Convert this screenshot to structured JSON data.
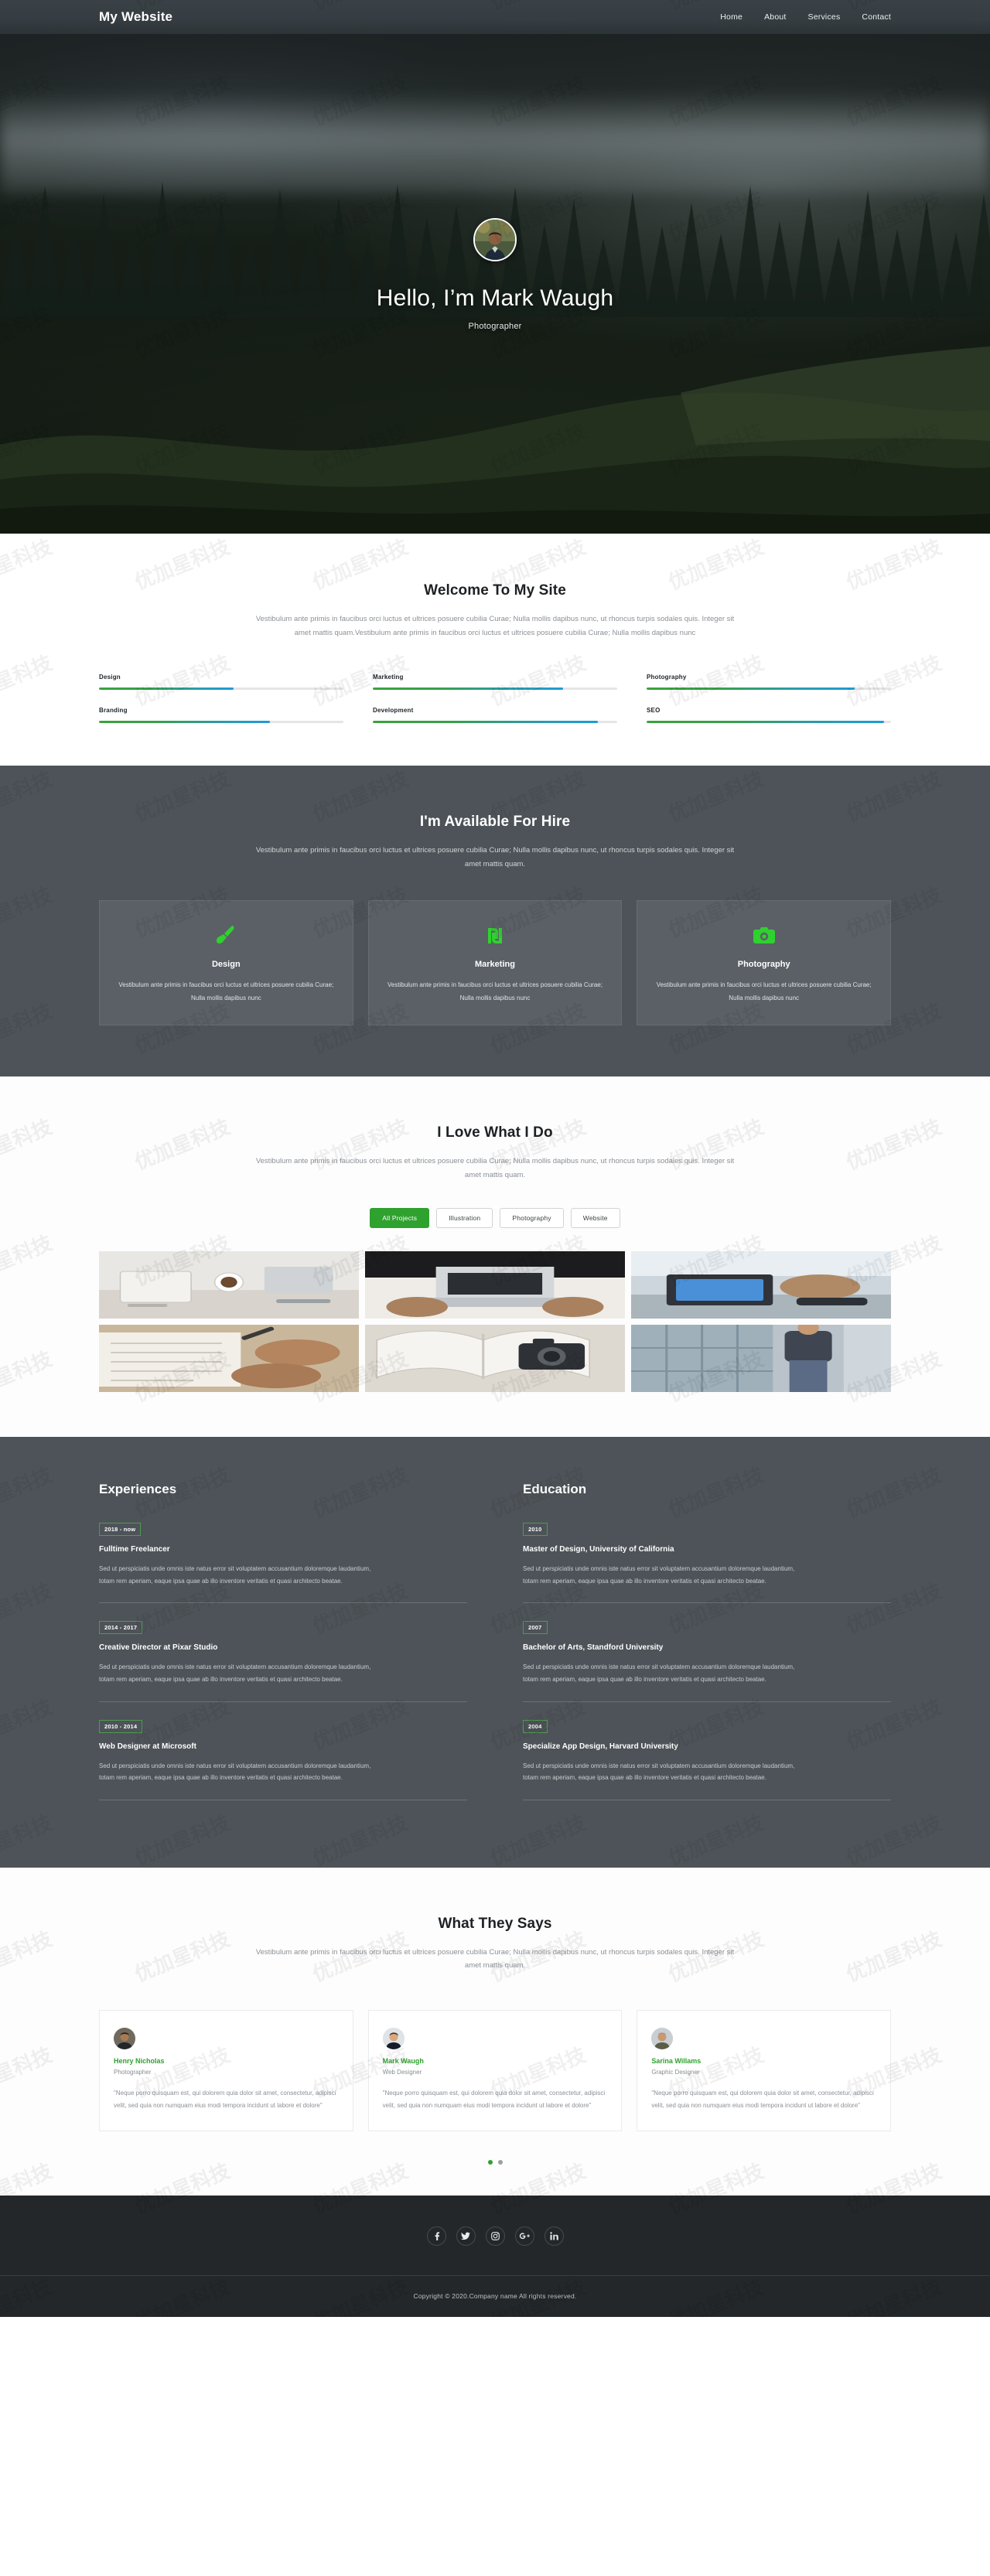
{
  "nav": {
    "brand": "My Website",
    "links": [
      {
        "label": "Home"
      },
      {
        "label": "About"
      },
      {
        "label": "Services"
      },
      {
        "label": "Contact"
      }
    ]
  },
  "hero": {
    "title": "Hello, I’m Mark Waugh",
    "subtitle": "Photographer",
    "avatar_icon": "profile-photo"
  },
  "welcome": {
    "title": "Welcome To My Site",
    "description": "Vestibulum ante primis in faucibus orci luctus et ultrices posuere cubilia Curae; Nulla mollis dapibus nunc, ut rhoncus turpis sodales quis. Integer sit amet mattis quam.Vestibulum ante primis in faucibus orci luctus et ultrices posuere cubilia Curae; Nulla mollis dapibus nunc",
    "skills": [
      {
        "label": "Design",
        "value": 55
      },
      {
        "label": "Marketing",
        "value": 78
      },
      {
        "label": "Photography",
        "value": 85
      },
      {
        "label": "Branding",
        "value": 70
      },
      {
        "label": "Development",
        "value": 92
      },
      {
        "label": "SEO",
        "value": 97
      }
    ]
  },
  "hire": {
    "title": "I'm Available For Hire",
    "description": "Vestibulum ante primis in faucibus orci luctus et ultrices posuere cubilia Curae; Nulla mollis dapibus nunc, ut rhoncus turpis sodales quis. Integer sit amet mattis quam.",
    "accent": "#2fd12f",
    "cards": [
      {
        "icon": "paintbrush-icon",
        "title": "Design",
        "text": "Vestibulum ante primis in faucibus orci luctus et ultrices posuere cubilia Curae; Nulla mollis dapibus nunc"
      },
      {
        "icon": "shekel-currency-icon",
        "title": "Marketing",
        "text": "Vestibulum ante primis in faucibus orci luctus et ultrices posuere cubilia Curae; Nulla mollis dapibus nunc"
      },
      {
        "icon": "camera-icon",
        "title": "Photography",
        "text": "Vestibulum ante primis in faucibus orci luctus et ultrices posuere cubilia Curae; Nulla mollis dapibus nunc"
      }
    ]
  },
  "portfolio": {
    "title": "I Love What I Do",
    "description": "Vestibulum ante primis in faucibus orci luctus et ultrices posuere cubilia Curae; Nulla mollis dapibus nunc, ut rhoncus turpis sodales quis. Integer sit amet mattis quam.",
    "filters": [
      {
        "label": "All Projects",
        "active": true
      },
      {
        "label": "Illustration",
        "active": false
      },
      {
        "label": "Photography",
        "active": false
      },
      {
        "label": "Website",
        "active": false
      }
    ],
    "items": [
      {
        "name": "desk-with-coffee-and-notes"
      },
      {
        "name": "hands-typing-on-laptop"
      },
      {
        "name": "person-using-tablet-at-desk"
      },
      {
        "name": "hands-writing-in-notebook"
      },
      {
        "name": "open-book-with-camera"
      },
      {
        "name": "person-standing-by-window"
      }
    ]
  },
  "resume": {
    "experiences": {
      "heading": "Experiences",
      "items": [
        {
          "date": "2018 - now",
          "title": "Fulltime Freelancer",
          "text": "Sed ut perspiciatis unde omnis iste natus error sit voluptatem accusantium doloremque laudantium, totam rem aperiam, eaque ipsa quae ab illo inventore veritatis et quasi architecto beatae."
        },
        {
          "date": "2014 - 2017",
          "title": "Creative Director at Pixar Studio",
          "text": "Sed ut perspiciatis unde omnis iste natus error sit voluptatem accusantium doloremque laudantium, totam rem aperiam, eaque ipsa quae ab illo inventore veritatis et quasi architecto beatae."
        },
        {
          "date": "2010 - 2014",
          "title": "Web Designer at Microsoft",
          "text": "Sed ut perspiciatis unde omnis iste natus error sit voluptatem accusantium doloremque laudantium, totam rem aperiam, eaque ipsa quae ab illo inventore veritatis et quasi architecto beatae."
        }
      ]
    },
    "education": {
      "heading": "Education",
      "items": [
        {
          "date": "2010",
          "title": "Master of Design, University of California",
          "text": "Sed ut perspiciatis unde omnis iste natus error sit voluptatem accusantium doloremque laudantium, totam rem aperiam, eaque ipsa quae ab illo inventore veritatis et quasi architecto beatae."
        },
        {
          "date": "2007",
          "title": "Bachelor of Arts, Standford University",
          "text": "Sed ut perspiciatis unde omnis iste natus error sit voluptatem accusantium doloremque laudantium, totam rem aperiam, eaque ipsa quae ab illo inventore veritatis et quasi architecto beatae."
        },
        {
          "date": "2004",
          "title": "Specialize App Design, Harvard University",
          "text": "Sed ut perspiciatis unde omnis iste natus error sit voluptatem accusantium doloremque laudantium, totam rem aperiam, eaque ipsa quae ab illo inventore veritatis et quasi architecto beatae."
        }
      ]
    }
  },
  "testimonials": {
    "title": "What They Says",
    "description": "Vestibulum ante primis in faucibus orci luctus et ultrices posuere cubilia Curae; Nulla mollis dapibus nunc, ut rhoncus turpis sodales quis. Integer sit amet mattis quam.",
    "items": [
      {
        "name": "Henry Nicholas",
        "role": "Photographer",
        "quote": "\"Neque porro quisquam est, qui dolorem quia dolor sit amet, consectetur, adipisci velit, sed quia non numquam eius modi tempora incidunt ut labore et dolore\""
      },
      {
        "name": "Mark Waugh",
        "role": "Web Designer",
        "quote": "\"Neque porro quisquam est, qui dolorem quia dolor sit amet, consectetur, adipisci velit, sed quia non numquam eius modi tempora incidunt ut labore et dolore\""
      },
      {
        "name": "Sarina Willams",
        "role": "Graphic Designer",
        "quote": "\"Neque porro quisquam est, qui dolorem quia dolor sit amet, consectetur, adipisci velit, sed quia non numquam eius modi tempora incidunt ut labore et dolore\""
      }
    ],
    "dots": [
      {
        "active": true
      },
      {
        "active": false
      }
    ]
  },
  "footer": {
    "socials": [
      {
        "icon": "facebook-icon"
      },
      {
        "icon": "twitter-icon"
      },
      {
        "icon": "instagram-icon"
      },
      {
        "icon": "google-plus-icon"
      },
      {
        "icon": "linkedin-icon"
      }
    ],
    "copyright": "Copyright © 2020.Company name All rights reserved."
  }
}
